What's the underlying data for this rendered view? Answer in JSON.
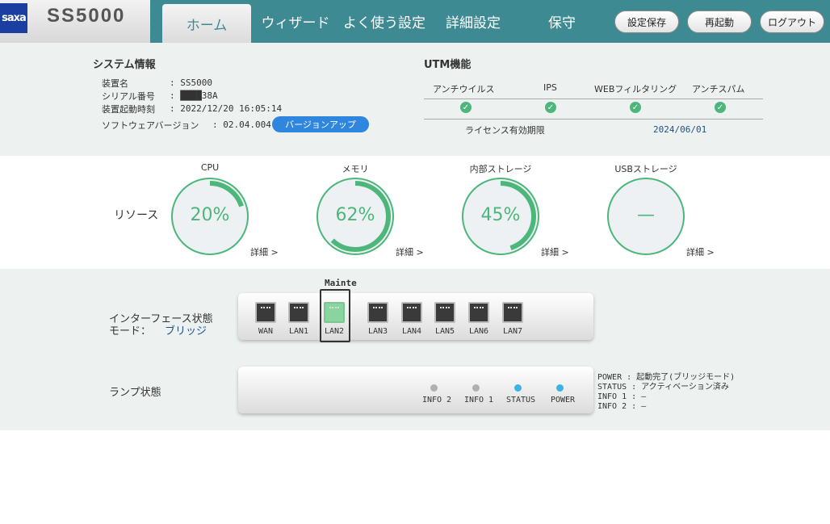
{
  "header": {
    "logo_text": "saxa",
    "model": "SS5000",
    "nav": [
      "ホーム",
      "ウィザード",
      "よく使う設定",
      "詳細設定",
      "保守"
    ],
    "buttons": [
      "設定保存",
      "再起動",
      "ログアウト"
    ],
    "accent_color": "#3e8a93"
  },
  "system": {
    "title": "システム情報",
    "device_name_label": "装置名",
    "device_name": ": SS5000",
    "serial_label": "シリアル番号",
    "serial": ": ████38A",
    "boot_time_label": "装置起動時刻",
    "boot_time": ": 2022/12/20 16:05:14",
    "software_label": "ソフトウェアバージョン",
    "software_version": ": 02.04.004",
    "upgrade_button": "バージョンアップ"
  },
  "utm": {
    "title": "UTM機能",
    "columns": [
      "アンチウイルス",
      "IPS",
      "WEBフィルタリング",
      "アンチスパム"
    ],
    "status": [
      "check-icon",
      "check-icon",
      "check-icon",
      "check-icon"
    ],
    "license_label": "ライセンス有効期限",
    "license_date": "2024/06/01"
  },
  "resources": {
    "title": "リソース",
    "detail_label": "詳細 >",
    "items": [
      {
        "name": "CPU",
        "value": "20%",
        "fraction": 0.2
      },
      {
        "name": "メモリ",
        "value": "62%",
        "fraction": 0.62
      },
      {
        "name": "内部ストレージ",
        "value": "45%",
        "fraction": 0.45
      },
      {
        "name": "USBストレージ",
        "value": "—",
        "fraction": 0
      }
    ],
    "gauge_color": "#4cb67b"
  },
  "interfaces": {
    "title": "インターフェース状態",
    "mode_label": "モード：",
    "mode_value": "ブリッジ",
    "mainte_label": "Mainte",
    "ports": [
      "WAN",
      "LAN1",
      "LAN2",
      "LAN3",
      "LAN4",
      "LAN5",
      "LAN6",
      "LAN7"
    ],
    "active_port": "LAN2"
  },
  "lamps": {
    "title": "ランプ状態",
    "leds": [
      {
        "name": "INFO 2",
        "color": "#b0b0b0"
      },
      {
        "name": "INFO 1",
        "color": "#b0b0b0"
      },
      {
        "name": "STATUS",
        "color": "#3bb3e6"
      },
      {
        "name": "POWER",
        "color": "#3bb3e6"
      }
    ],
    "status_lines": [
      "POWER  : 起動完了(ブリッジモード)",
      "STATUS : アクティベーション済み",
      "INFO 1 : —",
      "INFO 2 : —"
    ]
  }
}
